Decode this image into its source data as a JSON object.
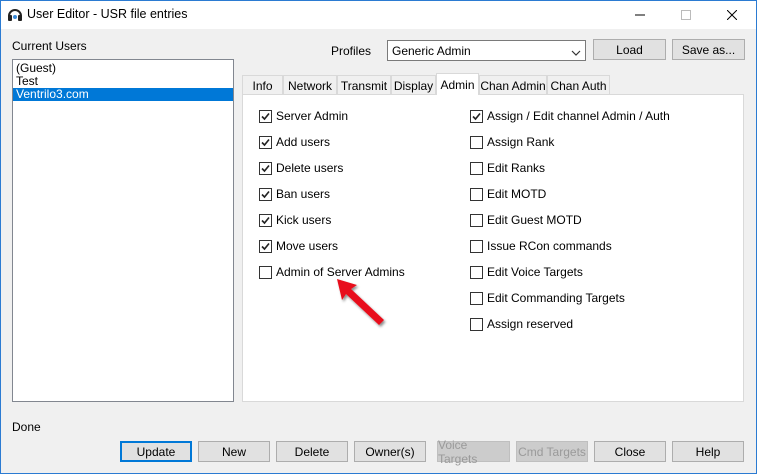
{
  "window": {
    "title": "User Editor - USR file entries",
    "icon": "ventrilo-headset-icon",
    "controls": [
      "minimize-icon",
      "maximize-icon",
      "close-icon"
    ]
  },
  "users": {
    "label": "Current Users",
    "items": [
      {
        "name": "(Guest)",
        "selected": false
      },
      {
        "name": "Test",
        "selected": false
      },
      {
        "name": "Ventrilo3.com",
        "selected": true
      }
    ]
  },
  "profiles": {
    "label": "Profiles",
    "selected": "Generic Admin",
    "load_label": "Load",
    "saveas_label": "Save as..."
  },
  "tabs": [
    "Info",
    "Network",
    "Transmit",
    "Display",
    "Admin",
    "Chan Admin",
    "Chan Auth"
  ],
  "active_tab": "Admin",
  "admin": {
    "left": [
      {
        "label": "Server Admin",
        "checked": true
      },
      {
        "label": "Add users",
        "checked": true
      },
      {
        "label": "Delete users",
        "checked": true
      },
      {
        "label": "Ban users",
        "checked": true
      },
      {
        "label": "Kick users",
        "checked": true
      },
      {
        "label": "Move users",
        "checked": true
      },
      {
        "label": "Admin of Server Admins",
        "checked": false
      }
    ],
    "right": [
      {
        "label": "Assign / Edit channel Admin / Auth",
        "checked": true
      },
      {
        "label": "Assign Rank",
        "checked": false
      },
      {
        "label": "Edit Ranks",
        "checked": false
      },
      {
        "label": "Edit MOTD",
        "checked": false
      },
      {
        "label": "Edit Guest MOTD",
        "checked": false
      },
      {
        "label": "Issue RCon commands",
        "checked": false
      },
      {
        "label": "Edit Voice Targets",
        "checked": false
      },
      {
        "label": "Edit Commanding Targets",
        "checked": false
      },
      {
        "label": "Assign reserved",
        "checked": false
      }
    ]
  },
  "annotation": {
    "icon": "red-arrow-icon",
    "color": "#e8101a"
  },
  "status": "Done",
  "buttons": {
    "update": "Update",
    "new": "New",
    "delete": "Delete",
    "owner": "Owner(s)",
    "voice_targets": "Voice Targets",
    "cmd_targets": "Cmd Targets",
    "close": "Close",
    "help": "Help"
  },
  "colors": {
    "accent": "#0078d7",
    "window_border": "#2b7bd2"
  }
}
